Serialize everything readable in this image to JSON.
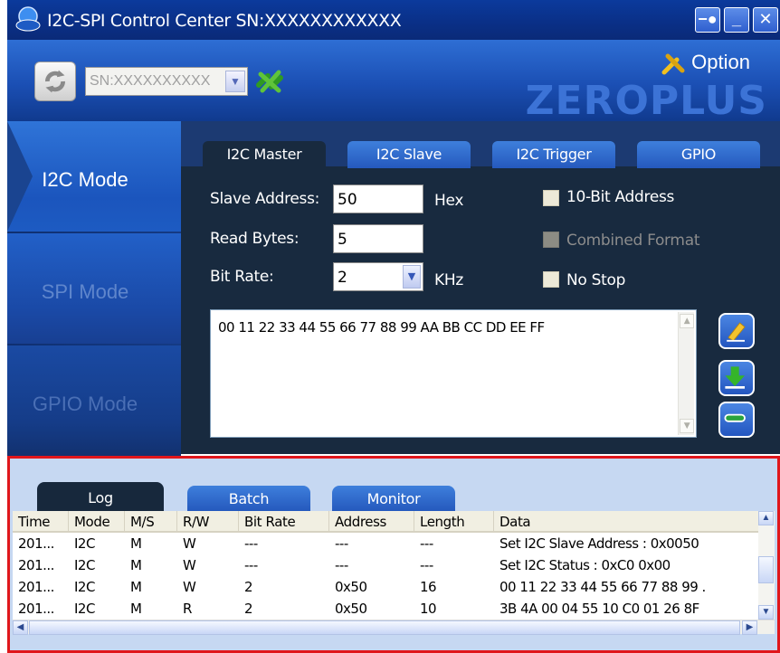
{
  "window": {
    "title": "I2C-SPI Control Center SN:XXXXXXXXXXXX",
    "controls": [
      "pin-icon",
      "minimize-icon",
      "close-icon"
    ]
  },
  "toolbar": {
    "serial_select_value": "SN:XXXXXXXXXX",
    "option_label": "Option",
    "brand": "ZEROPLUS"
  },
  "modes": [
    {
      "label": "I2C Mode",
      "active": true
    },
    {
      "label": "SPI Mode",
      "active": false
    },
    {
      "label": "GPIO Mode",
      "active": false
    }
  ],
  "tabs": [
    "I2C Master",
    "I2C Slave",
    "I2C Trigger",
    "GPIO"
  ],
  "form": {
    "slave_address_label": "Slave Address:",
    "slave_address_value": "50",
    "slave_address_unit": "Hex",
    "read_bytes_label": "Read Bytes:",
    "read_bytes_value": "5",
    "bit_rate_label": "Bit Rate:",
    "bit_rate_value": "2",
    "bit_rate_unit": "KHz",
    "options": [
      {
        "label": "10-Bit Address",
        "enabled": true,
        "checked": false
      },
      {
        "label": "Combined Format",
        "enabled": false,
        "checked": false
      },
      {
        "label": "No Stop",
        "enabled": true,
        "checked": false
      }
    ],
    "data_text": "00 11 22 33 44 55 66 77 88 99 AA BB CC DD EE FF"
  },
  "side_buttons": [
    "edit-icon",
    "download-icon",
    "minus-icon"
  ],
  "log": {
    "tabs": [
      "Log",
      "Batch",
      "Monitor"
    ],
    "columns": [
      "Time",
      "Mode",
      "M/S",
      "R/W",
      "Bit Rate",
      "Address",
      "Length",
      "Data"
    ],
    "rows": [
      [
        "201...",
        "I2C",
        "M",
        "W",
        "---",
        "---",
        "---",
        "Set I2C Slave Address : 0x0050"
      ],
      [
        "201...",
        "I2C",
        "M",
        "W",
        "---",
        "---",
        "---",
        "Set I2C Status : 0xC0 0x00"
      ],
      [
        "201...",
        "I2C",
        "M",
        "W",
        "2",
        "0x50",
        "16",
        "00 11 22 33 44 55 66 77 88 99 ."
      ],
      [
        "201...",
        "I2C",
        "M",
        "R",
        "2",
        "0x50",
        "10",
        "3B 4A 00 04 55 10 C0 01 26 8F"
      ]
    ]
  },
  "colors": {
    "title_bar": "#0a2f86",
    "mode_active": "#1b55bd",
    "content_bg": "#182a3f",
    "log_border": "#e0161b",
    "log_bg": "#c6d8f2"
  }
}
